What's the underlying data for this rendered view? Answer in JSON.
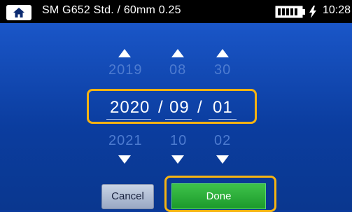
{
  "header": {
    "title": "SM G652 Std. / 60mm 0.25",
    "time": "10:28",
    "icons": {
      "home": "home-icon",
      "battery": "battery-icon",
      "charge": "lightning-icon"
    }
  },
  "date_picker": {
    "year": {
      "prev": "2019",
      "current": "2020",
      "next": "2021"
    },
    "month": {
      "prev": "08",
      "current": "09",
      "next": "10"
    },
    "day": {
      "prev": "30",
      "current": "01",
      "next": "02"
    },
    "separator": "/"
  },
  "actions": {
    "cancel_label": "Cancel",
    "done_label": "Done"
  },
  "colors": {
    "background": "#0a3a9c",
    "highlight": "#f6b312",
    "done": "#1c9a2b"
  }
}
